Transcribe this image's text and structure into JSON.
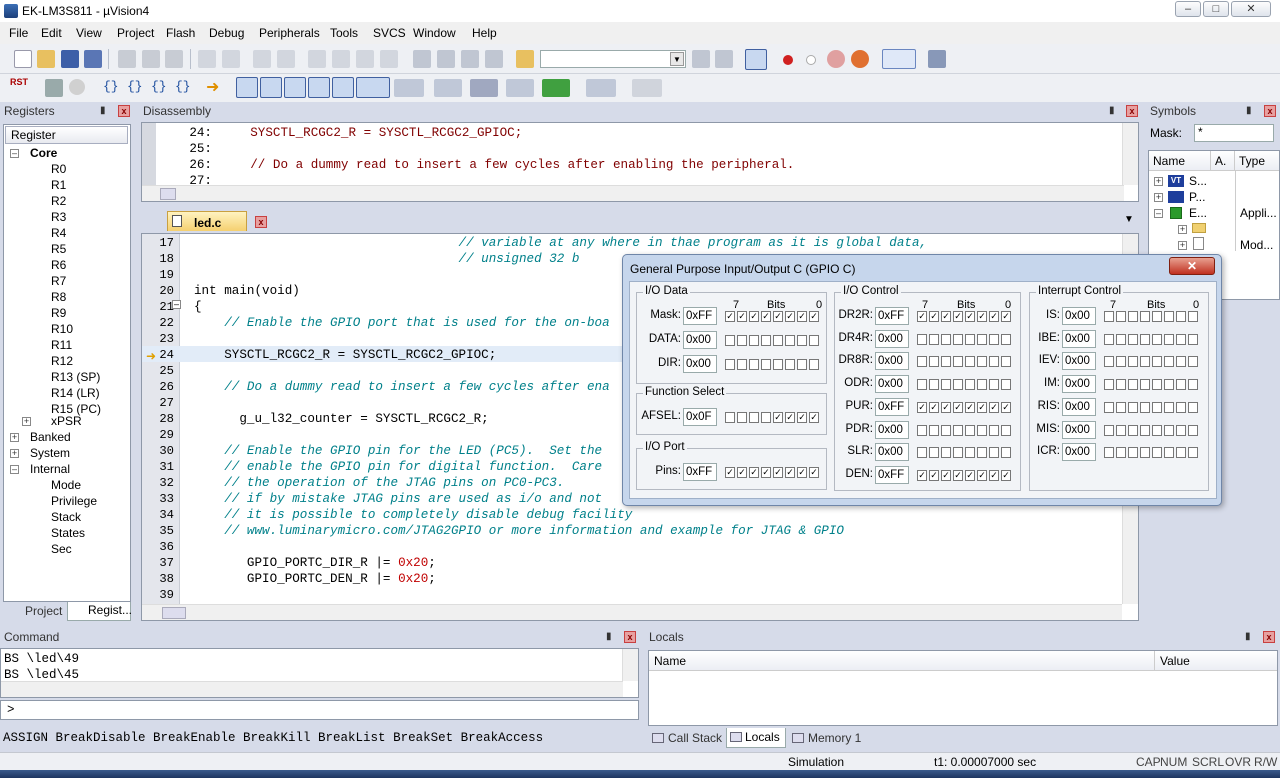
{
  "window": {
    "title": "EK-LM3S811  - µVision4"
  },
  "menu": [
    "File",
    "Edit",
    "View",
    "Project",
    "Flash",
    "Debug",
    "Peripherals",
    "Tools",
    "SVCS",
    "Window",
    "Help"
  ],
  "registers": {
    "title": "Registers",
    "column": "Register",
    "core_label": "Core",
    "regs": [
      "R0",
      "R1",
      "R2",
      "R3",
      "R4",
      "R5",
      "R6",
      "R7",
      "R8",
      "R9",
      "R10",
      "R11",
      "R12",
      "R13 (SP)",
      "R14 (LR)",
      "R15 (PC)",
      "xPSR"
    ],
    "groups": [
      "Banked",
      "System",
      "Internal"
    ],
    "internal": [
      "Mode",
      "Privilege",
      "Stack",
      "States",
      "Sec"
    ],
    "tabs": [
      "Project",
      "Regist..."
    ]
  },
  "disassembly": {
    "title": "Disassembly",
    "lines": [
      {
        "n": "24:",
        "code": "    SYSCTL_RCGC2_R = SYSCTL_RCGC2_GPIOC;"
      },
      {
        "n": "25:",
        "code": ""
      },
      {
        "n": "26:",
        "code": "    // Do a dummy read to insert a few cycles after enabling the peripheral."
      },
      {
        "n": "27:",
        "code": ""
      }
    ]
  },
  "editor": {
    "tab": "led.c",
    "lines": [
      {
        "n": "17",
        "code": "                                   // variable at any where in thae program as it is global data,",
        "cmt": true
      },
      {
        "n": "18",
        "code": "                                   // unsigned 32 b",
        "cmt": true
      },
      {
        "n": "19",
        "code": ""
      },
      {
        "n": "20",
        "code": "int main(void)"
      },
      {
        "n": "21",
        "code": "{"
      },
      {
        "n": "22",
        "code": "    // Enable the GPIO port that is used for the on-boa",
        "cmt": true
      },
      {
        "n": "23",
        "code": ""
      },
      {
        "n": "24",
        "code": "    SYSCTL_RCGC2_R = SYSCTL_RCGC2_GPIOC;"
      },
      {
        "n": "25",
        "code": ""
      },
      {
        "n": "26",
        "code": "    // Do a dummy read to insert a few cycles after ena",
        "cmt": true
      },
      {
        "n": "27",
        "code": ""
      },
      {
        "n": "28",
        "code": "      g_u_l32_counter = SYSCTL_RCGC2_R;"
      },
      {
        "n": "29",
        "code": ""
      },
      {
        "n": "30",
        "code": "    // Enable the GPIO pin for the LED (PC5).  Set the",
        "cmt": true
      },
      {
        "n": "31",
        "code": "    // enable the GPIO pin for digital function.  Care",
        "cmt": true
      },
      {
        "n": "32",
        "code": "    // the operation of the JTAG pins on PC0-PC3.",
        "cmt": true
      },
      {
        "n": "33",
        "code": "    // if by mistake JTAG pins are used as i/o and not",
        "cmt": true
      },
      {
        "n": "34",
        "code": "    // it is possible to completely disable debug facility",
        "cmt": true
      },
      {
        "n": "35",
        "code": "    // www.luminarymicro.com/JTAG2GPIO or more information and example for JTAG & GPIO",
        "cmt": true
      },
      {
        "n": "36",
        "code": ""
      },
      {
        "n": "37",
        "code": "       GPIO_PORTC_DIR_R |= ",
        "num": "0x20",
        "tail": ";"
      },
      {
        "n": "38",
        "code": "       GPIO_PORTC_DEN_R |= ",
        "num": "0x20",
        "tail": ";"
      },
      {
        "n": "39",
        "code": ""
      }
    ]
  },
  "gpio": {
    "title": "General Purpose Input/Output C (GPIO C)",
    "io_data": {
      "title": "I/O Data",
      "bits": "Bits",
      "b7": "7",
      "b0": "0",
      "rows": [
        {
          "label": "Mask:",
          "value": "0xFF",
          "bits": [
            1,
            1,
            1,
            1,
            1,
            1,
            1,
            1
          ]
        },
        {
          "label": "DATA:",
          "value": "0x00",
          "bits": [
            0,
            0,
            0,
            0,
            0,
            0,
            0,
            0
          ]
        },
        {
          "label": "DIR:",
          "value": "0x00",
          "bits": [
            0,
            0,
            0,
            0,
            0,
            0,
            0,
            0
          ]
        }
      ]
    },
    "func_select": {
      "title": "Function Select",
      "rows": [
        {
          "label": "AFSEL:",
          "value": "0x0F",
          "bits": [
            0,
            0,
            0,
            0,
            1,
            1,
            1,
            1
          ]
        }
      ]
    },
    "io_port": {
      "title": "I/O Port",
      "rows": [
        {
          "label": "Pins:",
          "value": "0xFF",
          "bits": [
            1,
            1,
            1,
            1,
            1,
            1,
            1,
            1
          ]
        }
      ]
    },
    "io_control": {
      "title": "I/O Control",
      "bits": "Bits",
      "b7": "7",
      "b0": "0",
      "rows": [
        {
          "label": "DR2R:",
          "value": "0xFF",
          "bits": [
            1,
            1,
            1,
            1,
            1,
            1,
            1,
            1
          ]
        },
        {
          "label": "DR4R:",
          "value": "0x00",
          "bits": [
            0,
            0,
            0,
            0,
            0,
            0,
            0,
            0
          ]
        },
        {
          "label": "DR8R:",
          "value": "0x00",
          "bits": [
            0,
            0,
            0,
            0,
            0,
            0,
            0,
            0
          ]
        },
        {
          "label": "ODR:",
          "value": "0x00",
          "bits": [
            0,
            0,
            0,
            0,
            0,
            0,
            0,
            0
          ]
        },
        {
          "label": "PUR:",
          "value": "0xFF",
          "bits": [
            1,
            1,
            1,
            1,
            1,
            1,
            1,
            1
          ]
        },
        {
          "label": "PDR:",
          "value": "0x00",
          "bits": [
            0,
            0,
            0,
            0,
            0,
            0,
            0,
            0
          ]
        },
        {
          "label": "SLR:",
          "value": "0x00",
          "bits": [
            0,
            0,
            0,
            0,
            0,
            0,
            0,
            0
          ]
        },
        {
          "label": "DEN:",
          "value": "0xFF",
          "bits": [
            1,
            1,
            1,
            1,
            1,
            1,
            1,
            1
          ]
        }
      ]
    },
    "int_control": {
      "title": "Interrupt Control",
      "bits": "Bits",
      "b7": "7",
      "b0": "0",
      "rows": [
        {
          "label": "IS:",
          "value": "0x00",
          "bits": [
            0,
            0,
            0,
            0,
            0,
            0,
            0,
            0
          ]
        },
        {
          "label": "IBE:",
          "value": "0x00",
          "bits": [
            0,
            0,
            0,
            0,
            0,
            0,
            0,
            0
          ]
        },
        {
          "label": "IEV:",
          "value": "0x00",
          "bits": [
            0,
            0,
            0,
            0,
            0,
            0,
            0,
            0
          ]
        },
        {
          "label": "IM:",
          "value": "0x00",
          "bits": [
            0,
            0,
            0,
            0,
            0,
            0,
            0,
            0
          ]
        },
        {
          "label": "RIS:",
          "value": "0x00",
          "bits": [
            0,
            0,
            0,
            0,
            0,
            0,
            0,
            0
          ]
        },
        {
          "label": "MIS:",
          "value": "0x00",
          "bits": [
            0,
            0,
            0,
            0,
            0,
            0,
            0,
            0
          ]
        },
        {
          "label": "ICR:",
          "value": "0x00",
          "bits": [
            0,
            0,
            0,
            0,
            0,
            0,
            0,
            0
          ]
        }
      ]
    }
  },
  "symbols": {
    "title": "Symbols",
    "mask_label": "Mask:",
    "mask_value": "*",
    "col_name": "Name",
    "col_a": "A.",
    "col_type": "Type",
    "rows": [
      {
        "name": "S...",
        "type": ""
      },
      {
        "name": "P...",
        "type": ""
      },
      {
        "name": "E...",
        "type": "Appli..."
      },
      {
        "name": "",
        "type": ""
      },
      {
        "name": "",
        "type": "Mod..."
      }
    ]
  },
  "command": {
    "title": "Command",
    "lines": [
      "BS \\led\\49",
      "BS \\led\\45"
    ],
    "prompt": ">",
    "hint": "ASSIGN BreakDisable BreakEnable BreakKill BreakList BreakSet BreakAccess"
  },
  "locals": {
    "title": "Locals",
    "col_name": "Name",
    "col_value": "Value",
    "tabs": [
      "Call Stack",
      "Locals",
      "Memory 1"
    ]
  },
  "status": {
    "mode": "Simulation",
    "time": "t1: 0.00007000 sec",
    "flags": [
      "CAP",
      "NUM",
      "SCRL",
      "OVR",
      "R/W"
    ]
  }
}
